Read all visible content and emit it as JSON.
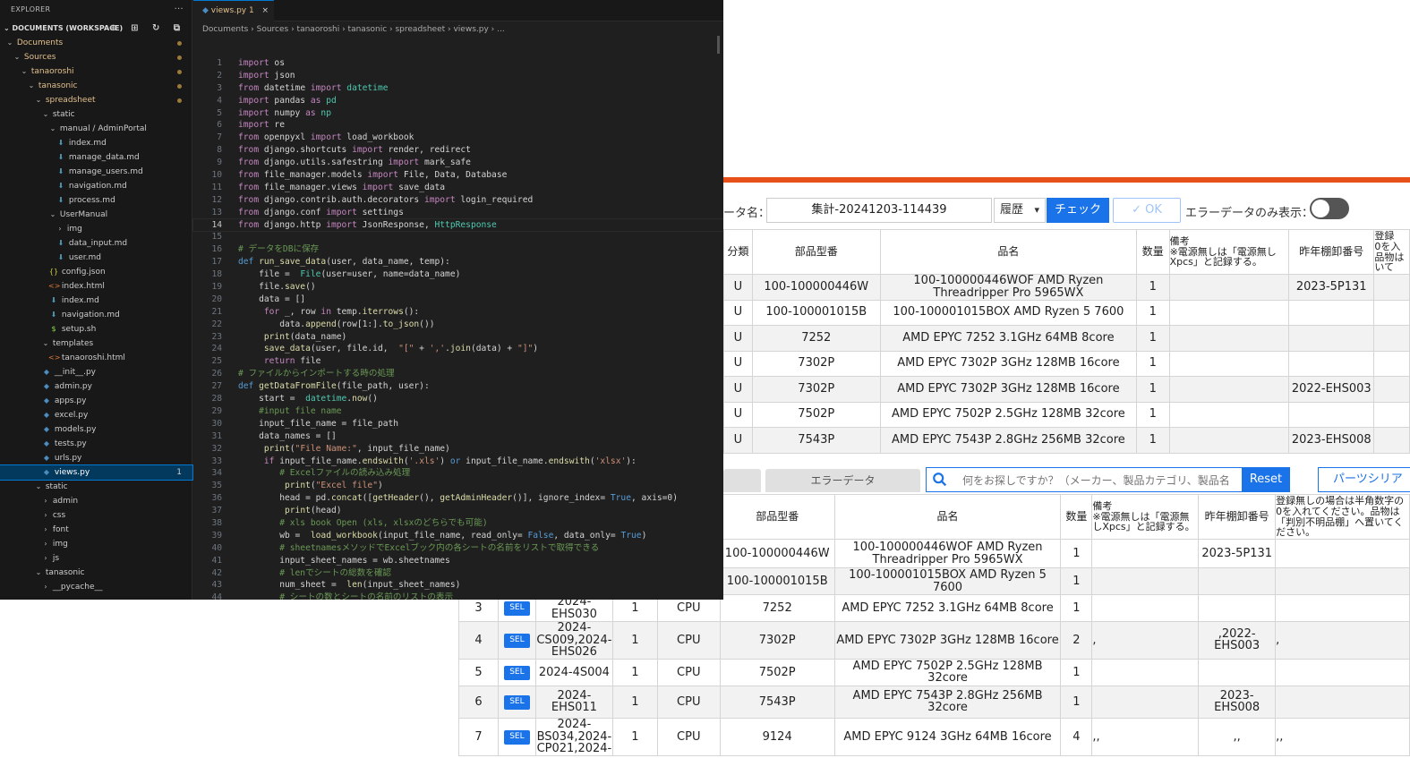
{
  "vscode": {
    "explorer_title": "EXPLORER",
    "explorer_more": "···",
    "workspace_label": "DOCUMENTS (WORKSPACE)",
    "workspace_actions": "⊕ ⊞ ↻ ⧉",
    "tree": [
      {
        "label": "Documents",
        "depth": 0,
        "type": "folder",
        "open": true,
        "modified": true
      },
      {
        "label": "Sources",
        "depth": 1,
        "type": "folder",
        "open": true,
        "modified": true
      },
      {
        "label": "tanaoroshi",
        "depth": 2,
        "type": "folder",
        "open": true,
        "modified": true
      },
      {
        "label": "tanasonic",
        "depth": 3,
        "type": "folder",
        "open": true,
        "modified": true
      },
      {
        "label": "spreadsheet",
        "depth": 4,
        "type": "folder",
        "open": true,
        "modified": true
      },
      {
        "label": "static",
        "depth": 5,
        "type": "folder",
        "open": true
      },
      {
        "label": "manual / AdminPortal",
        "depth": 6,
        "type": "folder",
        "open": true
      },
      {
        "label": "index.md",
        "depth": 7,
        "type": "md"
      },
      {
        "label": "manage_data.md",
        "depth": 7,
        "type": "md"
      },
      {
        "label": "manage_users.md",
        "depth": 7,
        "type": "md"
      },
      {
        "label": "navigation.md",
        "depth": 7,
        "type": "md"
      },
      {
        "label": "process.md",
        "depth": 7,
        "type": "md"
      },
      {
        "label": "UserManual",
        "depth": 6,
        "type": "folder",
        "open": true
      },
      {
        "label": "img",
        "depth": 7,
        "type": "folder",
        "open": false
      },
      {
        "label": "data_input.md",
        "depth": 7,
        "type": "md"
      },
      {
        "label": "user.md",
        "depth": 7,
        "type": "md"
      },
      {
        "label": "config.json",
        "depth": 6,
        "type": "json"
      },
      {
        "label": "index.html",
        "depth": 6,
        "type": "html"
      },
      {
        "label": "index.md",
        "depth": 6,
        "type": "md"
      },
      {
        "label": "navigation.md",
        "depth": 6,
        "type": "md"
      },
      {
        "label": "setup.sh",
        "depth": 6,
        "type": "sh"
      },
      {
        "label": "templates",
        "depth": 5,
        "type": "folder",
        "open": true
      },
      {
        "label": "tanaoroshi.html",
        "depth": 6,
        "type": "html"
      },
      {
        "label": "__init__.py",
        "depth": 5,
        "type": "py"
      },
      {
        "label": "admin.py",
        "depth": 5,
        "type": "py"
      },
      {
        "label": "apps.py",
        "depth": 5,
        "type": "py"
      },
      {
        "label": "excel.py",
        "depth": 5,
        "type": "py"
      },
      {
        "label": "models.py",
        "depth": 5,
        "type": "py"
      },
      {
        "label": "tests.py",
        "depth": 5,
        "type": "py"
      },
      {
        "label": "urls.py",
        "depth": 5,
        "type": "py"
      },
      {
        "label": "views.py",
        "depth": 5,
        "type": "py",
        "active": true,
        "badge": "1"
      },
      {
        "label": "static",
        "depth": 4,
        "type": "folder",
        "open": true
      },
      {
        "label": "admin",
        "depth": 5,
        "type": "folder",
        "open": false
      },
      {
        "label": "css",
        "depth": 5,
        "type": "folder",
        "open": false
      },
      {
        "label": "font",
        "depth": 5,
        "type": "folder",
        "open": false
      },
      {
        "label": "img",
        "depth": 5,
        "type": "folder",
        "open": false
      },
      {
        "label": "js",
        "depth": 5,
        "type": "folder",
        "open": false
      },
      {
        "label": "tanasonic",
        "depth": 4,
        "type": "folder",
        "open": true
      },
      {
        "label": "__pycache__",
        "depth": 5,
        "type": "folder",
        "open": false
      }
    ],
    "tab": {
      "label": "views.py",
      "count": "1",
      "close": "×"
    },
    "breadcrumb": "Documents › Sources › tanaoroshi › tanasonic › spreadsheet › views.py › ...",
    "current_line": 14,
    "code": [
      [
        [
          "k",
          "import"
        ],
        [
          "",
          "os"
        ]
      ],
      [
        [
          "k",
          "import"
        ],
        [
          "",
          "json"
        ]
      ],
      [
        [
          "k",
          "from"
        ],
        [
          "",
          "datetime"
        ],
        [
          "k",
          "import"
        ],
        [
          "t",
          "datetime"
        ]
      ],
      [
        [
          "k",
          "import"
        ],
        [
          "",
          "pandas"
        ],
        [
          "k",
          "as"
        ],
        [
          "t",
          "pd"
        ]
      ],
      [
        [
          "k",
          "import"
        ],
        [
          "",
          "numpy"
        ],
        [
          "k",
          "as"
        ],
        [
          "t",
          "np"
        ]
      ],
      [
        [
          "k",
          "import"
        ],
        [
          "",
          "re"
        ]
      ],
      [
        [
          "k",
          "from"
        ],
        [
          "",
          "openpyxl"
        ],
        [
          "k",
          "import"
        ],
        [
          "",
          "load_workbook"
        ]
      ],
      [
        [
          "k",
          "from"
        ],
        [
          "",
          "django.shortcuts"
        ],
        [
          "k",
          "import"
        ],
        [
          "",
          "render, redirect"
        ]
      ],
      [
        [
          "k",
          "from"
        ],
        [
          "",
          "django.utils.safestring"
        ],
        [
          "k",
          "import"
        ],
        [
          "",
          "mark_safe"
        ]
      ],
      [
        [
          "k",
          "from"
        ],
        [
          "",
          "file_manager.models"
        ],
        [
          "k",
          "import"
        ],
        [
          "",
          "File, Data, Database"
        ]
      ],
      [
        [
          "k",
          "from"
        ],
        [
          "",
          "file_manager.views"
        ],
        [
          "k",
          "import"
        ],
        [
          "",
          "save_data"
        ]
      ],
      [
        [
          "k",
          "from"
        ],
        [
          "",
          "django.contrib.auth.decorators"
        ],
        [
          "k",
          "import"
        ],
        [
          "",
          "login_required"
        ]
      ],
      [
        [
          "k",
          "from"
        ],
        [
          "",
          "django.conf"
        ],
        [
          "k",
          "import"
        ],
        [
          "",
          "settings"
        ]
      ],
      [
        [
          "k",
          "from"
        ],
        [
          "",
          "django.http"
        ],
        [
          "k",
          "import"
        ],
        [
          "",
          "JsonResponse,"
        ],
        [
          "t",
          "HttpResponse"
        ]
      ],
      [],
      [
        [
          "c",
          "# データをDBに保存"
        ]
      ],
      [
        [
          "kb",
          "def"
        ],
        [
          "f",
          "run_save_data"
        ],
        [
          "",
          "(user, data_name, temp):"
        ]
      ],
      [
        [
          "",
          "    file = "
        ],
        [
          "t",
          "File"
        ],
        [
          "",
          "(user=user, name=data_name)"
        ]
      ],
      [
        [
          "",
          "    file."
        ],
        [
          "f",
          "save"
        ],
        [
          "",
          "()"
        ]
      ],
      [
        [
          "",
          "    data = []"
        ]
      ],
      [
        [
          "",
          "    "
        ],
        [
          "k",
          "for"
        ],
        [
          "",
          "_, row"
        ],
        [
          "k",
          "in"
        ],
        [
          "",
          "temp."
        ],
        [
          "f",
          "iterrows"
        ],
        [
          "",
          "():"
        ]
      ],
      [
        [
          "",
          "        data."
        ],
        [
          "f",
          "append"
        ],
        [
          "",
          "(row[1:]."
        ],
        [
          "f",
          "to_json"
        ],
        [
          "",
          "())"
        ]
      ],
      [
        [
          "",
          "    "
        ],
        [
          "f",
          "print"
        ],
        [
          "",
          "(data_name)"
        ]
      ],
      [
        [
          "",
          "    "
        ],
        [
          "f",
          "save_data"
        ],
        [
          "",
          "(user, file.id, "
        ],
        [
          "s",
          "\"[\""
        ],
        [
          "",
          "+"
        ],
        [
          "s",
          "','"
        ],
        [
          "",
          "."
        ],
        [
          "f",
          "join"
        ],
        [
          "",
          "(data) +"
        ],
        [
          "s",
          "\"]\""
        ],
        [
          "",
          ")"
        ]
      ],
      [
        [
          "",
          "    "
        ],
        [
          "k",
          "return"
        ],
        [
          "",
          "file"
        ]
      ],
      [
        [
          "c",
          "# ファイルからインポートする時の処理"
        ]
      ],
      [
        [
          "kb",
          "def"
        ],
        [
          "f",
          "getDataFromFile"
        ],
        [
          "",
          "(file_path, user):"
        ]
      ],
      [
        [
          "",
          "    start = "
        ],
        [
          "t",
          "datetime"
        ],
        [
          "",
          "."
        ],
        [
          "f",
          "now"
        ],
        [
          "",
          "()"
        ]
      ],
      [
        [
          "c",
          "    #input file name"
        ]
      ],
      [
        [
          "",
          "    input_file_name = file_path"
        ]
      ],
      [
        [
          "",
          "    data_names = []"
        ]
      ],
      [
        [
          "",
          "    "
        ],
        [
          "f",
          "print"
        ],
        [
          "",
          "("
        ],
        [
          "s",
          "\"File Name:\""
        ],
        [
          "",
          ", input_file_name)"
        ]
      ],
      [
        [
          "",
          "    "
        ],
        [
          "k",
          "if"
        ],
        [
          "",
          "input_file_name."
        ],
        [
          "f",
          "endswith"
        ],
        [
          "",
          "("
        ],
        [
          "s",
          "'.xls'"
        ],
        [
          "",
          ")"
        ],
        [
          "kb",
          "or"
        ],
        [
          "",
          "input_file_name."
        ],
        [
          "f",
          "endswith"
        ],
        [
          "",
          "("
        ],
        [
          "s",
          "'xlsx'"
        ],
        [
          "",
          "):"
        ]
      ],
      [
        [
          "c",
          "        # Excelファイルの読み込み処理"
        ]
      ],
      [
        [
          "",
          "        "
        ],
        [
          "f",
          "print"
        ],
        [
          "",
          "("
        ],
        [
          "s",
          "\"Excel file\""
        ],
        [
          "",
          ")"
        ]
      ],
      [
        [
          "",
          "        head = pd."
        ],
        [
          "f",
          "concat"
        ],
        [
          "",
          "(["
        ],
        [
          "f",
          "getHeader"
        ],
        [
          "",
          "(),"
        ],
        [
          "f",
          "getAdminHeader"
        ],
        [
          "",
          "()], ignore_index="
        ],
        [
          "kb",
          "True"
        ],
        [
          "",
          ", axis=0)"
        ]
      ],
      [
        [
          "",
          "        "
        ],
        [
          "f",
          "print"
        ],
        [
          "",
          "(head)"
        ]
      ],
      [
        [
          "c",
          "        # xls book Open (xls, xlsxのどちらでも可能)"
        ]
      ],
      [
        [
          "",
          "        wb = "
        ],
        [
          "f",
          "load_workbook"
        ],
        [
          "",
          "(input_file_name, read_only="
        ],
        [
          "kb",
          "False"
        ],
        [
          "",
          ", data_only="
        ],
        [
          "kb",
          "True"
        ],
        [
          "",
          ")"
        ]
      ],
      [
        [
          "c",
          "        # sheetnamesメソッドでExcelブック内の各シートの名前をリストで取得できる"
        ]
      ],
      [
        [
          "",
          "        input_sheet_names = wb.sheetnames"
        ]
      ],
      [
        [
          "c",
          "        # lenでシートの総数を確認"
        ]
      ],
      [
        [
          "",
          "        num_sheet = "
        ],
        [
          "f",
          "len"
        ],
        [
          "",
          "(input_sheet_names)"
        ]
      ],
      [
        [
          "c",
          "        # シートの数とシートの名前のリストの表示"
        ]
      ]
    ]
  },
  "webapp": {
    "data_name_label": "ータ名：",
    "data_name_value": "集計-20241203-114439",
    "history_label": "履歴",
    "check_button": "チェック",
    "ok_button": "✓ OK",
    "error_only_label": "エラーデータのみ表示：",
    "table1": {
      "headers": [
        "分類",
        "部品型番",
        "品名",
        "数量",
        "備考\n※電源無しは「電源無しXpcs」と記録する。",
        "昨年棚卸番号",
        "登録\n0を入\n品物は\nいて"
      ],
      "rows": [
        [
          "U",
          "100-100000446W",
          "100-100000446WOF AMD Ryzen Threadripper Pro 5965WX",
          "1",
          "",
          "2023-5P131",
          ""
        ],
        [
          "U",
          "100-100001015B",
          "100-100001015BOX AMD Ryzen 5 7600",
          "1",
          "",
          "",
          ""
        ],
        [
          "U",
          "7252",
          "AMD EPYC 7252 3.1GHz 64MB 8core",
          "1",
          "",
          "",
          ""
        ],
        [
          "U",
          "7302P",
          "AMD EPYC 7302P 3GHz 128MB 16core",
          "1",
          "",
          "",
          ""
        ],
        [
          "U",
          "7302P",
          "AMD EPYC 7302P 3GHz 128MB 16core",
          "1",
          "",
          "2022-EHS003",
          ""
        ],
        [
          "U",
          "7502P",
          "AMD EPYC 7502P 2.5GHz 128MB 32core",
          "1",
          "",
          "",
          ""
        ],
        [
          "U",
          "7543P",
          "AMD EPYC 7543P 2.8GHz 256MB 32core",
          "1",
          "",
          "2023-EHS008",
          ""
        ]
      ]
    },
    "tab_error_data": "エラーデータ",
    "search_placeholder": "何をお探しですか？（メーカー、製品カテゴリ、製品名",
    "reset_button": "Reset",
    "parts_button": "パーツシリア",
    "table2": {
      "headers": [
        "",
        "",
        "",
        "",
        "",
        "部品型番",
        "品名",
        "数量",
        "備考\n※電源無しは「電源無しXpcs」と記録する。",
        "昨年棚卸番号",
        "登録無しの場合は半角数字の0を入れてください。品物は「判別不明品棚」へ置いてください。"
      ],
      "sel_label": "SEL",
      "rows": [
        [
          "",
          "",
          "",
          "",
          "",
          "100-100000446W",
          "100-100000446WOF AMD Ryzen Threadripper Pro 5965WX",
          "1",
          "",
          "2023-5P131",
          ""
        ],
        [
          "",
          "",
          "",
          "",
          "",
          "100-100001015B",
          "100-100001015BOX AMD Ryzen 5 7600",
          "1",
          "",
          "",
          ""
        ],
        [
          "3",
          "SEL",
          "2024-\nEHS030",
          "1",
          "CPU",
          "7252",
          "AMD EPYC 7252 3.1GHz 64MB 8core",
          "1",
          "",
          "",
          ""
        ],
        [
          "4",
          "SEL",
          "2024-\nCS009,2024-\nEHS026",
          "1",
          "CPU",
          "7302P",
          "AMD EPYC 7302P 3GHz 128MB 16core",
          "2",
          ",",
          ",2022-\nEHS003",
          ","
        ],
        [
          "5",
          "SEL",
          "2024-4S004",
          "1",
          "CPU",
          "7502P",
          "AMD EPYC 7502P 2.5GHz 128MB 32core",
          "1",
          "",
          "",
          ""
        ],
        [
          "6",
          "SEL",
          "2024-\nEHS011",
          "1",
          "CPU",
          "7543P",
          "AMD EPYC 7543P 2.8GHz 256MB 32core",
          "1",
          "",
          "2023-\nEHS008",
          ""
        ],
        [
          "7",
          "SEL",
          "2024-\nBS034,2024-\nCP021,2024-",
          "1",
          "CPU",
          "9124",
          "AMD EPYC 9124 3GHz 64MB 16core",
          "4",
          ",,",
          ",,",
          ",,"
        ]
      ]
    }
  }
}
